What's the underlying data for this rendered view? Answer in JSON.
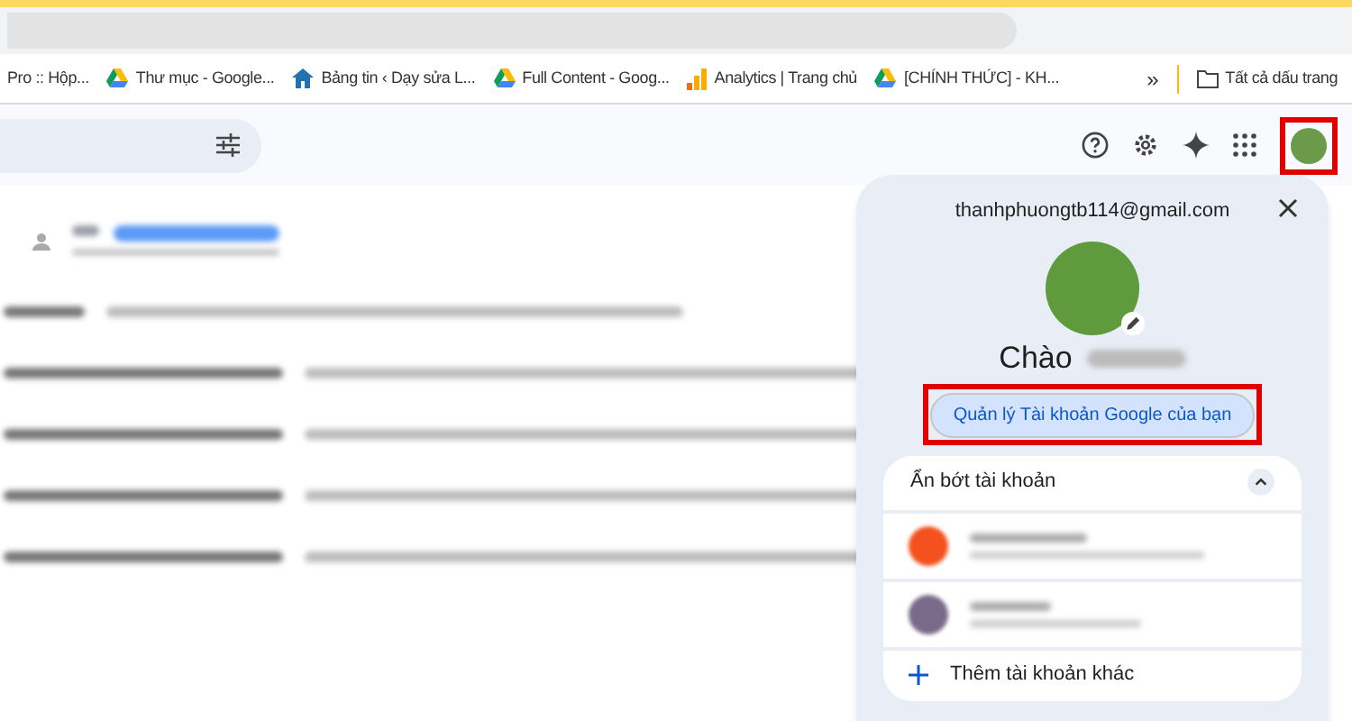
{
  "bookmarks": [
    {
      "label": "Pro :: Hộp...",
      "kind": "none"
    },
    {
      "label": "Thư mục - Google...",
      "kind": "drive"
    },
    {
      "label": "Bảng tin ‹ Dạy sửa L...",
      "kind": "home"
    },
    {
      "label": "Full Content - Goog...",
      "kind": "drive"
    },
    {
      "label": "Analytics | Trang chủ",
      "kind": "analytics"
    },
    {
      "label": "[CHÍNH THỨC] - KH...",
      "kind": "drive"
    }
  ],
  "bookmarks_overflow": "»",
  "all_bookmarks": "Tất cả dấu trang",
  "account_avatar": {
    "highlighted": true
  },
  "account_panel": {
    "email": "thanhphuongtb114@gmail.com",
    "greeting": "Chào",
    "manage_button": {
      "label": "Quản lý Tài khoản Google của bạn",
      "highlighted": true
    },
    "accounts_section": {
      "title": "Ẩn bớt tài khoản",
      "expanded": true
    },
    "add_account": "Thêm tài khoản khác"
  }
}
